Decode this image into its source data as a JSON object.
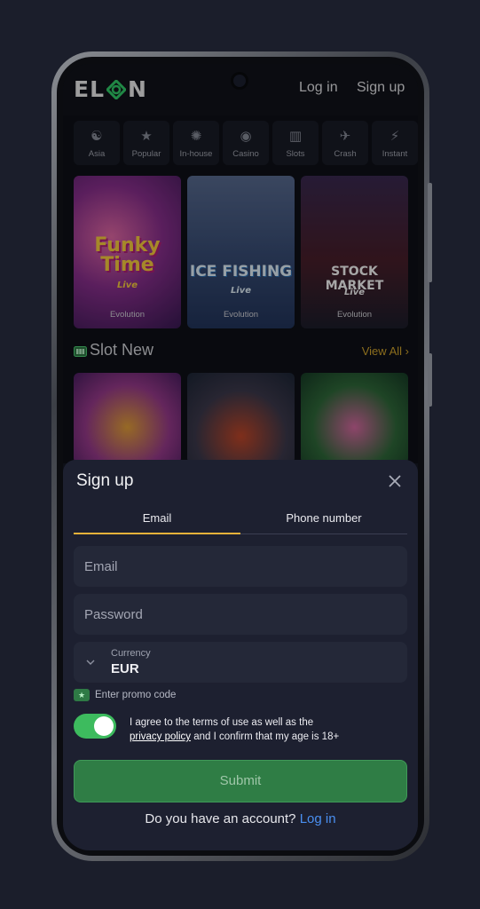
{
  "header": {
    "logo": "ELON",
    "login_label": "Log in",
    "signup_label": "Sign up"
  },
  "categories": [
    {
      "label": "Asia",
      "icon": "yin-yang-icon"
    },
    {
      "label": "Popular",
      "icon": "star-icon"
    },
    {
      "label": "In-house",
      "icon": "chip-icon"
    },
    {
      "label": "Casino",
      "icon": "roulette-icon"
    },
    {
      "label": "Slots",
      "icon": "slot-machine-icon"
    },
    {
      "label": "Crash",
      "icon": "plane-icon"
    },
    {
      "label": "Instant",
      "icon": "lightning-icon"
    }
  ],
  "live_games": [
    {
      "title": "Funky Time",
      "subtitle": "Live",
      "provider": "Evolution"
    },
    {
      "title": "ICE FISHING",
      "subtitle": "Live",
      "provider": "Evolution"
    },
    {
      "title": "STOCK MARKET",
      "subtitle": "Live",
      "provider": "Evolution"
    }
  ],
  "slot_section": {
    "title": "Slot New",
    "view_all": "View All"
  },
  "signup": {
    "title": "Sign up",
    "tabs": [
      "Email",
      "Phone number"
    ],
    "active_tab": "Email",
    "email_placeholder": "Email",
    "password_placeholder": "Password",
    "currency_label": "Currency",
    "currency_value": "EUR",
    "promo_label": "Enter promo code",
    "agree_prefix": "I agree to the terms of use as well as the",
    "agree_link": "privacy policy",
    "agree_suffix": "and I confirm that my age is 18+",
    "toggle_on": true,
    "submit_label": "Submit",
    "have_account": "Do you have an account?",
    "login_link": "Log in"
  },
  "colors": {
    "accent": "#e8b23a",
    "submit": "#2f7d45",
    "toggle": "#3dbb5e",
    "link": "#4a8ff0"
  }
}
